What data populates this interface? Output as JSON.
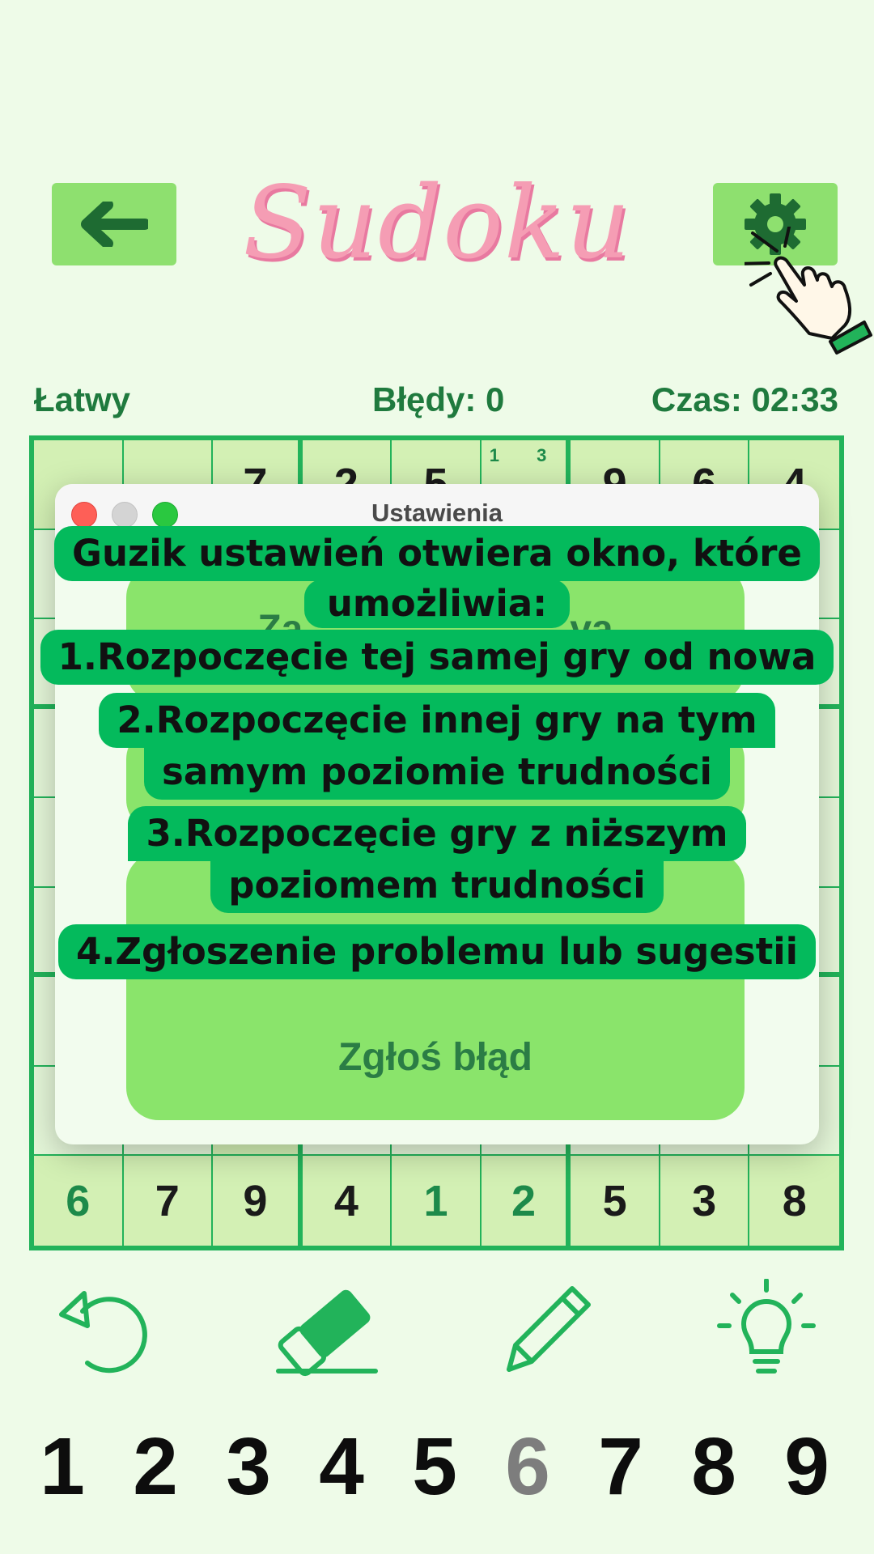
{
  "header": {
    "title": "Sudoku",
    "back_icon": "arrow-left-icon",
    "settings_icon": "gear-icon"
  },
  "status": {
    "level": "Łatwy",
    "errors": "Błędy: 0",
    "time": "Czas: 02:33"
  },
  "board": {
    "row1": [
      "",
      "",
      "7",
      "2",
      "5",
      "",
      "9",
      "6",
      "4"
    ],
    "row1_notes": [
      "1",
      "3"
    ],
    "row9": [
      "6",
      "7",
      "9",
      "4",
      "1",
      "2",
      "5",
      "3",
      "8"
    ]
  },
  "dialog": {
    "title": "Ustawienia",
    "buttons": [
      "Za…wa",
      "",
      "",
      "Zgłoś błąd"
    ],
    "button_visible_fragments": {
      "b1_left": "Za",
      "b1_right": "va"
    }
  },
  "callout": {
    "lines": [
      "Guzik ustawień otwiera okno, które",
      "umożliwia:",
      "1.Rozpoczęcie tej samej gry od nowa",
      "2.Rozpoczęcie innej gry na tym",
      "samym poziomie trudności",
      "3.Rozpoczęcie gry z niższym",
      "poziomem trudności",
      "4.Zgłoszenie problemu lub sugestii"
    ]
  },
  "tools": [
    "undo-icon",
    "eraser-icon",
    "pencil-icon",
    "lightbulb-icon"
  ],
  "numpad": [
    "1",
    "2",
    "3",
    "4",
    "5",
    "6",
    "7",
    "8",
    "9"
  ],
  "numpad_dimmed": "6",
  "colors": {
    "background": "#eefbe8",
    "accent_green": "#22b35a",
    "button_green": "#8ee06f",
    "callout_green": "#04ba5c",
    "title_pink": "#f59db4"
  }
}
